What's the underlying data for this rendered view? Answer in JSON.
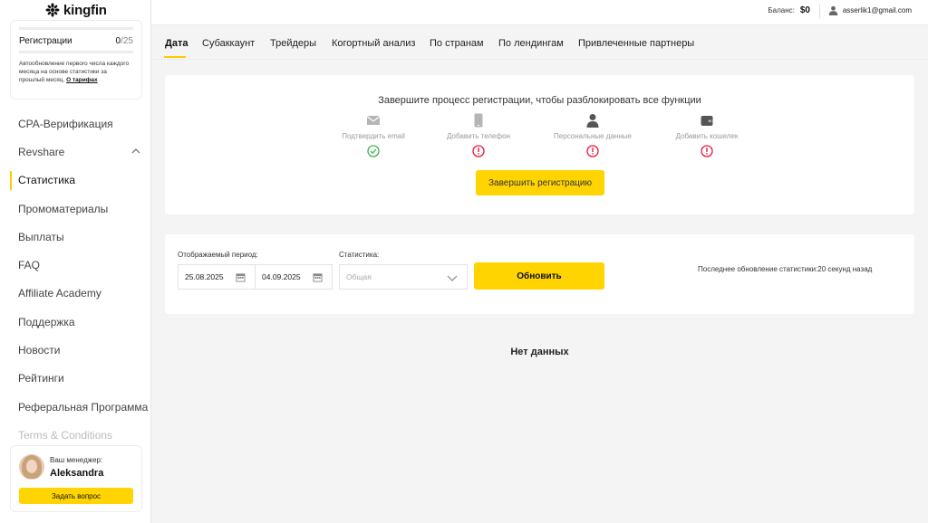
{
  "brand": {
    "name": "kingfin"
  },
  "registration_card": {
    "label": "Регистрации",
    "count": "0",
    "total": "/25",
    "note": "Автообновление первого числа каждого месяца на основе статистики за прошлый месяц.",
    "tariff_link": "О тарифах"
  },
  "sidebar": {
    "items": [
      {
        "label": "CPA-Верификация"
      },
      {
        "label": "Revshare"
      },
      {
        "label": "Статистика"
      },
      {
        "label": "Промоматериалы"
      },
      {
        "label": "Выплаты"
      },
      {
        "label": "FAQ"
      },
      {
        "label": "Affiliate Academy"
      },
      {
        "label": "Поддержка"
      },
      {
        "label": "Новости"
      },
      {
        "label": "Рейтинги"
      },
      {
        "label": "Реферальная Программа"
      },
      {
        "label": "Terms & Conditions"
      }
    ],
    "active_index": 2
  },
  "manager": {
    "label": "Ваш менеджер:",
    "name": "Aleksandra",
    "ask_button": "Задать вопрос"
  },
  "topbar": {
    "balance_label": "Баланс:",
    "balance_value": "$0",
    "user_email": "asserlik1@gmail.com"
  },
  "tabs": [
    {
      "label": "Дата"
    },
    {
      "label": "Субаккаунт"
    },
    {
      "label": "Трейдеры"
    },
    {
      "label": "Когортный анализ"
    },
    {
      "label": "По странам"
    },
    {
      "label": "По лендингам"
    },
    {
      "label": "Привлеченные партнеры"
    }
  ],
  "registration_panel": {
    "title": "Завершите процесс регистрации, чтобы разблокировать все функции",
    "steps": [
      {
        "label": "Подтвердить email",
        "icon": "envelope-icon",
        "status": "done"
      },
      {
        "label": "Добавить телефон",
        "icon": "phone-icon",
        "status": "pending"
      },
      {
        "label": "Персональные данные",
        "icon": "person-icon",
        "status": "pending"
      },
      {
        "label": "Добавить кошелек",
        "icon": "wallet-icon",
        "status": "pending"
      }
    ],
    "finish_button": "Завершить регистрацию"
  },
  "filters": {
    "period_label": "Отображаемый период:",
    "date_from": "25.08.2025",
    "date_to": "04.09.2025",
    "stats_label": "Статистика:",
    "stats_selected": "Общая",
    "refresh_button": "Обновить",
    "last_update": "Последнее обновление статистики:20 секунд назад"
  },
  "empty_state": {
    "text": "Нет данных"
  },
  "colors": {
    "accent": "#ffd400",
    "success": "#3bb54a",
    "warning": "#e5173f"
  }
}
